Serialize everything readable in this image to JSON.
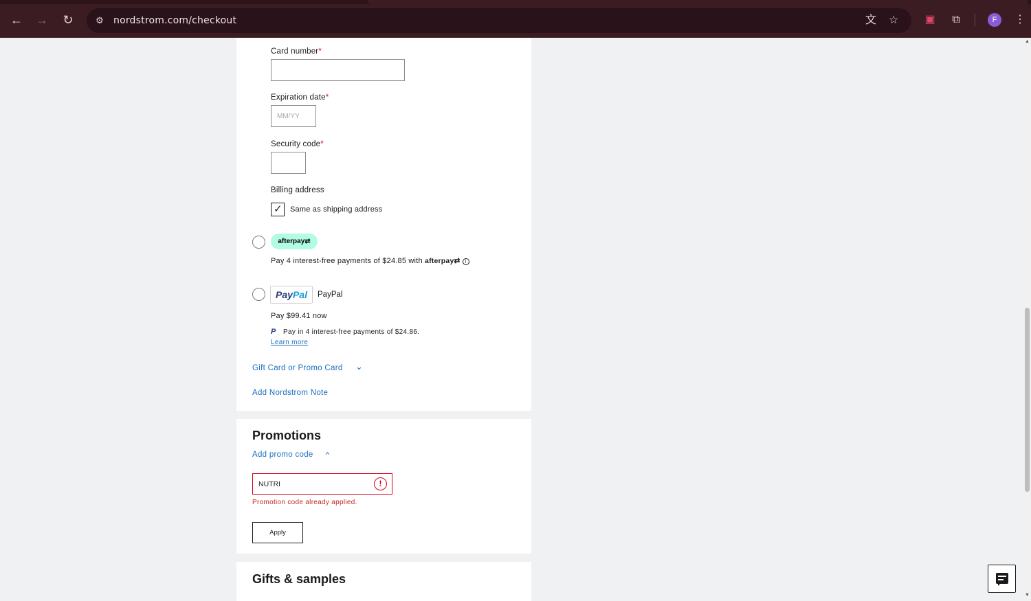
{
  "browser": {
    "url": "nordstrom.com/checkout",
    "back_icon": "←",
    "forward_icon": "→",
    "reload_icon": "↻",
    "site_info_icon": "⚙",
    "translate_icon": "文",
    "bookmark_icon": "☆",
    "extension_icon": "▣",
    "puzzle_icon": "⧉",
    "menu_icon": "⋮",
    "profile_initial": "F"
  },
  "payment": {
    "card_number_label": "Card number",
    "expiration_label": "Expiration date",
    "expiration_placeholder": "MM/YY",
    "security_label": "Security code",
    "required_mark": "*",
    "billing_label": "Billing address",
    "same_as_shipping_label": "Same as shipping address",
    "same_as_shipping_checked": true,
    "afterpay": {
      "logo_text": "afterpay⇄",
      "text": "Pay 4 interest-free payments of $24.85 with",
      "brand": "afterpay⇄",
      "info": "i"
    },
    "paypal": {
      "logo_pay": "Pay",
      "logo_pal": "Pal",
      "label": "PayPal",
      "pay_now": "Pay $99.41 now",
      "mini_icon": "P",
      "pay_in_4": "Pay in 4 interest-free payments of $24.86.",
      "learn_more": "Learn more"
    },
    "gift_card_link": "Gift Card or Promo Card",
    "gift_card_chevron": "⌄",
    "nordstrom_note_link": "Add Nordstrom Note"
  },
  "promotions": {
    "title": "Promotions",
    "add_promo_link": "Add promo code",
    "add_promo_chevron": "⌃",
    "promo_value": "NUTRI",
    "error_icon": "!",
    "error_message": "Promotion code already applied.",
    "apply_label": "Apply"
  },
  "gifts": {
    "title": "Gifts & samples"
  },
  "colors": {
    "accent_link": "#1b6ec2",
    "error": "#d6001c",
    "afterpay_mint": "#b2fce4",
    "paypal_navy": "#253b80",
    "paypal_blue": "#179bd7"
  }
}
